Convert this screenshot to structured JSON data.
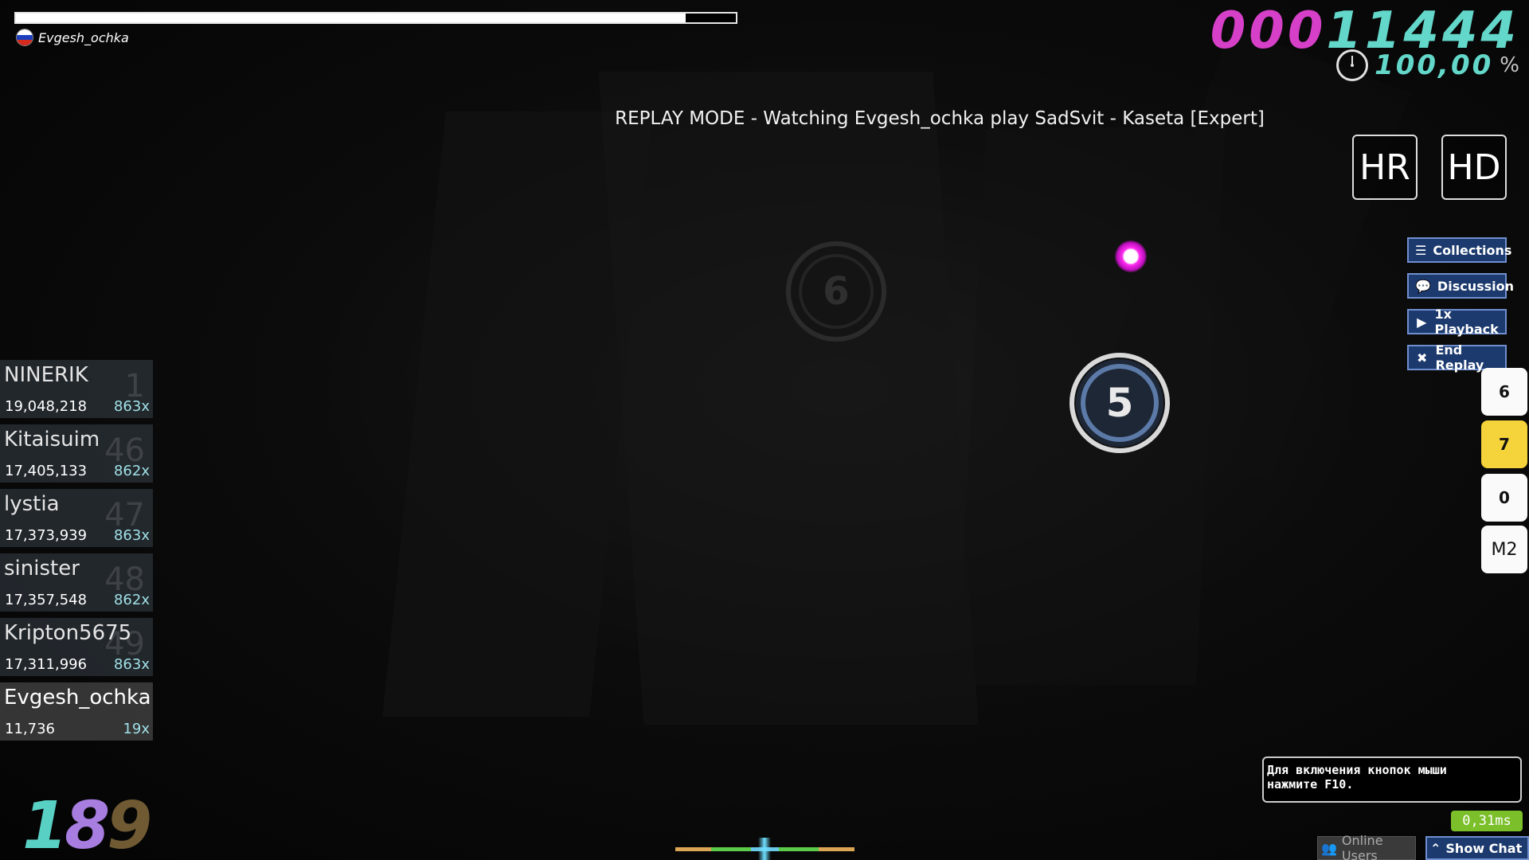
{
  "player": {
    "name": "Evgesh_ochka",
    "health_fraction": 0.93
  },
  "score": {
    "digits": "00011444",
    "accuracy": "100,00",
    "accuracy_unit": "%"
  },
  "banner": {
    "text": "REPLAY MODE - Watching Evgesh_ochka play SadSvit - Kaseta [Expert]"
  },
  "mods": [
    "HR",
    "HD"
  ],
  "side_buttons": {
    "collections": "Collections",
    "discussion": "Discussion",
    "playback": "1x Playback",
    "end_replay": "End Replay"
  },
  "keys": {
    "k1": "6",
    "k2": "7",
    "m1": "0",
    "m2": "M2"
  },
  "hit_objects": {
    "upcoming_number": "6",
    "current_number": "5"
  },
  "leaderboard": [
    {
      "name": "NINERIK",
      "rank": "1",
      "score": "19,048,218",
      "combo": "863x"
    },
    {
      "name": "Kitaisuim",
      "rank": "46",
      "score": "17,405,133",
      "combo": "862x"
    },
    {
      "name": "lystia",
      "rank": "47",
      "score": "17,373,939",
      "combo": "863x"
    },
    {
      "name": "sinister",
      "rank": "48",
      "score": "17,357,548",
      "combo": "862x"
    },
    {
      "name": "Kripton5675",
      "rank": "49",
      "score": "17,311,996",
      "combo": "863x"
    },
    {
      "name": "Evgesh_ochka",
      "rank": "",
      "score": "11,736",
      "combo": "19x"
    }
  ],
  "combo": {
    "d1": "1",
    "d2": "8",
    "d3": "9"
  },
  "tooltip": {
    "line1": "Для включения кнопок мыши",
    "line2": "нажмите F10."
  },
  "latency": "0,31ms",
  "bottom": {
    "online_users": "Online Users",
    "show_chat": "Show Chat"
  },
  "colors": {
    "score_dim": "#d640c8",
    "score_lit": "#63d7c9",
    "button_bg": "#1c3a6e",
    "latency_bg": "#7bbf2a",
    "key_active": "#f4d43a"
  }
}
